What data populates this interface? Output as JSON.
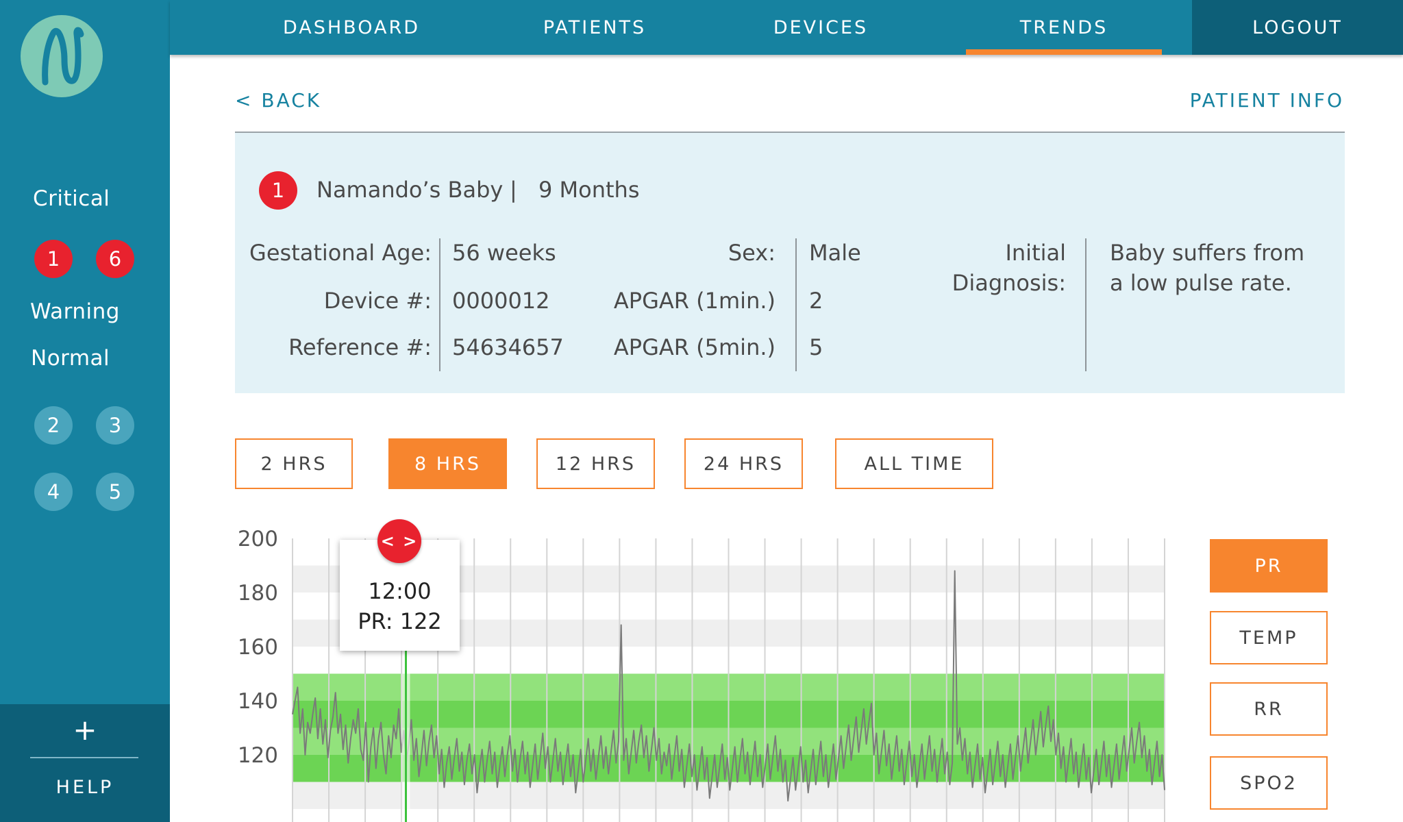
{
  "brand": {
    "logo_icon": "wave-n-logo-icon",
    "logo_color": "#7ecab5"
  },
  "colors": {
    "teal": "#1682a0",
    "dark_teal": "#0d5f78",
    "accent": "#f7852e",
    "critical": "#e8222e",
    "card_bg": "#e3f2f7"
  },
  "nav": {
    "items": [
      {
        "label": "DASHBOARD"
      },
      {
        "label": "PATIENTS"
      },
      {
        "label": "DEVICES"
      },
      {
        "label": "TRENDS",
        "active": true
      }
    ],
    "logout_label": "LOGOUT"
  },
  "sidebar": {
    "critical_label": "Critical",
    "critical_badges": [
      "1",
      "6"
    ],
    "warning_label": "Warning",
    "normal_label": "Normal",
    "normal_badges": [
      "2",
      "3",
      "4",
      "5"
    ],
    "help_icon": "plus-icon",
    "help_plus": "+",
    "help_label": "HELP"
  },
  "header": {
    "back_label": "< BACK",
    "patient_info_label": "PATIENT INFO"
  },
  "patient": {
    "alert_number": "1",
    "name": "Namando’s Baby",
    "separator": "|",
    "age": "9 Months",
    "fields": {
      "gestational_age_label": "Gestational Age:",
      "gestational_age": "56 weeks",
      "device_label": "Device #:",
      "device": "0000012",
      "reference_label": "Reference #:",
      "reference": "54634657",
      "sex_label": "Sex:",
      "sex": "Male",
      "apgar1_label": "APGAR (1min.)",
      "apgar1": "2",
      "apgar5_label": "APGAR (5min.)",
      "apgar5": "5",
      "diagnosis_label_line1": "Initial",
      "diagnosis_label_line2": "Diagnosis:",
      "diagnosis_line1": "Baby suffers from",
      "diagnosis_line2": "a low pulse rate."
    }
  },
  "time_ranges": [
    {
      "label": "2 HRS"
    },
    {
      "label": "8 HRS",
      "active": true
    },
    {
      "label": "12 HRS"
    },
    {
      "label": "24 HRS"
    },
    {
      "label": "ALL TIME"
    }
  ],
  "metrics": [
    {
      "label": "PR",
      "active": true
    },
    {
      "label": "TEMP"
    },
    {
      "label": "RR"
    },
    {
      "label": "SPO2"
    }
  ],
  "tooltip": {
    "time": "12:00",
    "value": "PR: 122",
    "handle_label": "< >",
    "handle_icon": "scrub-handle-icon"
  },
  "chart_data": {
    "type": "line",
    "title": "",
    "xlabel": "",
    "ylabel": "",
    "ylim": [
      100,
      200
    ],
    "yticks": [
      120,
      140,
      160,
      180,
      200
    ],
    "normal_band": [
      110,
      150
    ],
    "inner_band": [
      120,
      140
    ],
    "vertical_gridlines": 24,
    "grid": true,
    "cursor_x_fraction": 0.13,
    "series": [
      {
        "values": [
          135,
          140,
          145,
          128,
          137,
          120,
          132,
          128,
          135,
          141,
          126,
          137,
          124,
          133,
          119,
          129,
          134,
          143,
          128,
          135,
          122,
          131,
          117,
          126,
          133,
          128,
          137,
          122,
          118,
          132,
          110,
          123,
          130,
          115,
          126,
          132,
          120,
          113,
          127,
          119,
          131,
          126,
          137,
          121,
          129,
          117,
          124,
          133,
          118,
          126,
          112,
          120,
          129,
          116,
          125,
          131,
          119,
          127,
          113,
          122,
          108,
          117,
          123,
          111,
          119,
          126,
          114,
          121,
          109,
          118,
          124,
          113,
          120,
          106,
          115,
          122,
          110,
          118,
          125,
          113,
          121,
          108,
          116,
          123,
          112,
          120,
          127,
          114,
          122,
          110,
          118,
          125,
          113,
          121,
          108,
          116,
          124,
          111,
          119,
          128,
          115,
          123,
          110,
          118,
          126,
          114,
          121,
          109,
          117,
          124,
          112,
          120,
          106,
          114,
          122,
          110,
          118,
          126,
          114,
          122,
          111,
          119,
          127,
          115,
          123,
          113,
          121,
          129,
          117,
          125,
          168,
          118,
          126,
          113,
          121,
          129,
          117,
          125,
          131,
          119,
          127,
          114,
          122,
          130,
          118,
          126,
          113,
          121,
          116,
          124,
          111,
          119,
          127,
          114,
          122,
          108,
          116,
          124,
          112,
          120,
          107,
          115,
          123,
          111,
          119,
          104,
          112,
          120,
          108,
          116,
          124,
          111,
          119,
          107,
          115,
          123,
          110,
          118,
          126,
          113,
          121,
          109,
          117,
          125,
          112,
          120,
          108,
          116,
          124,
          111,
          119,
          127,
          114,
          122,
          110,
          118,
          103,
          111,
          119,
          107,
          115,
          123,
          110,
          118,
          106,
          114,
          122,
          109,
          117,
          125,
          112,
          120,
          108,
          116,
          124,
          111,
          119,
          127,
          115,
          123,
          131,
          118,
          126,
          134,
          121,
          129,
          137,
          124,
          132,
          139,
          120,
          128,
          113,
          121,
          129,
          116,
          124,
          111,
          119,
          127,
          114,
          122,
          109,
          117,
          125,
          112,
          120,
          108,
          116,
          124,
          111,
          119,
          127,
          114,
          122,
          110,
          118,
          126,
          113,
          121,
          109,
          117,
          188,
          124,
          130,
          118,
          126,
          113,
          121,
          108,
          116,
          124,
          111,
          119,
          106,
          114,
          122,
          109,
          117,
          125,
          112,
          120,
          108,
          116,
          124,
          111,
          119,
          127,
          114,
          122,
          130,
          117,
          125,
          133,
          120,
          128,
          136,
          123,
          131,
          138,
          125,
          133,
          120,
          128,
          115,
          123,
          110,
          118,
          126,
          113,
          121,
          108,
          116,
          124,
          111,
          119,
          106,
          114,
          122,
          109,
          117,
          125,
          112,
          120,
          108,
          116,
          124,
          111,
          119,
          127,
          114,
          122,
          130,
          117,
          125,
          132,
          119,
          127,
          114,
          122,
          109,
          117,
          125,
          112,
          120,
          107
        ]
      }
    ]
  }
}
